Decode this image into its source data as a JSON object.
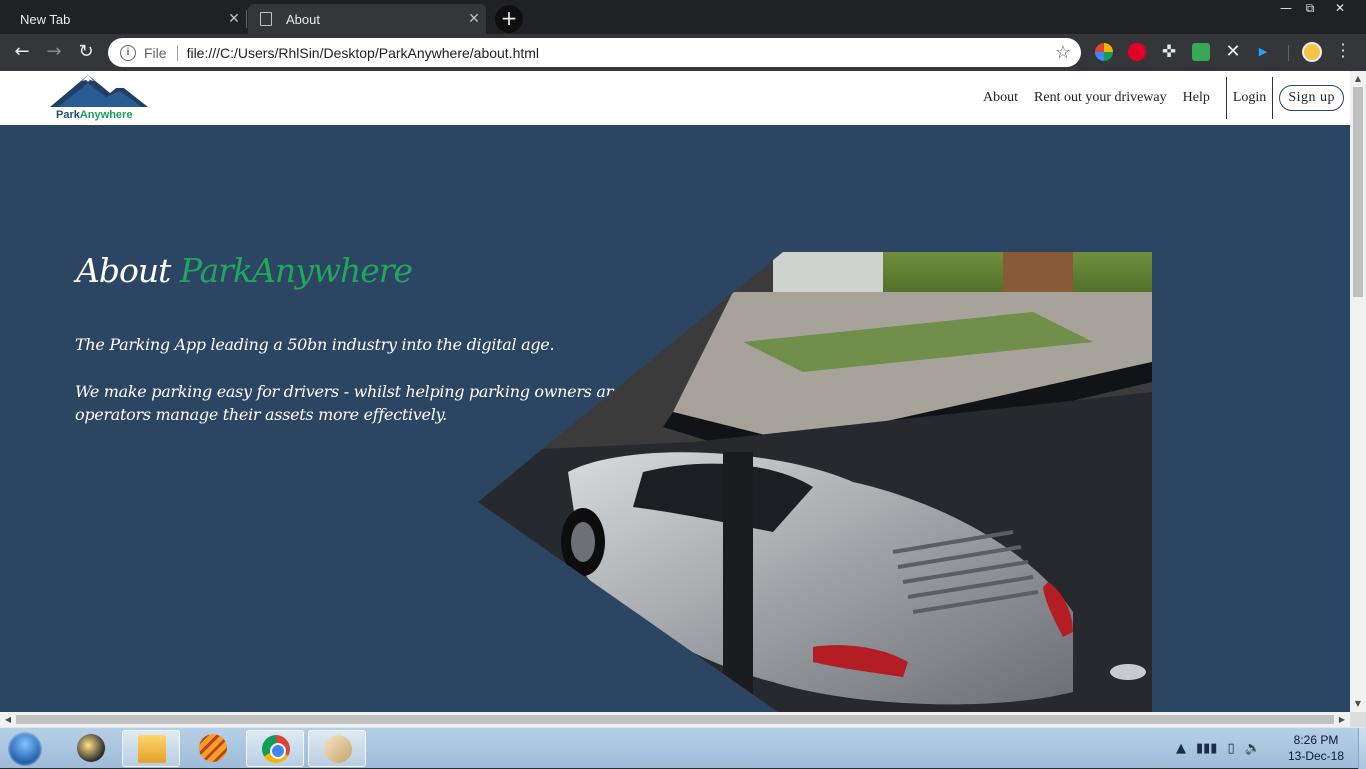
{
  "browser": {
    "tabs": [
      {
        "label": "New Tab",
        "active": false
      },
      {
        "label": "About",
        "active": true
      }
    ],
    "address": {
      "scheme_label": "File",
      "url": "file:///C:/Users/RhlSin/Desktop/ParkAnywhere/about.html"
    },
    "window_controls": {
      "minimize": "—",
      "maximize": "⧉",
      "close": "✕"
    },
    "extensions": [
      "google-drive-icon",
      "adblock-icon",
      "puzzle-icon",
      "mail-check-icon",
      "x-extension-icon",
      "play-extension-icon"
    ]
  },
  "site": {
    "logo": {
      "text_part1": "Park",
      "text_part2": "Anywhere"
    },
    "nav": {
      "about": "About",
      "rent": "Rent out your driveway",
      "help": "Help",
      "login": "Login",
      "signup": "Sign up"
    },
    "hero": {
      "title_prefix": "About",
      "title_brand": "ParkAnywhere",
      "tagline": "The Parking App leading a 50bn industry into the digital age.",
      "description": "We make parking easy for drivers - whilst helping parking owners and operators manage their assets more effectively."
    },
    "colors": {
      "background": "#2c4563",
      "brand_green": "#1fa75e",
      "header_bg": "#ffffff"
    }
  },
  "taskbar": {
    "apps": [
      "start-orb",
      "bee-app-icon",
      "file-explorer-icon",
      "striped-app-icon",
      "chrome-icon",
      "paint-icon"
    ],
    "clock": {
      "time": "8:26 PM",
      "date": "13-Dec-18"
    }
  }
}
